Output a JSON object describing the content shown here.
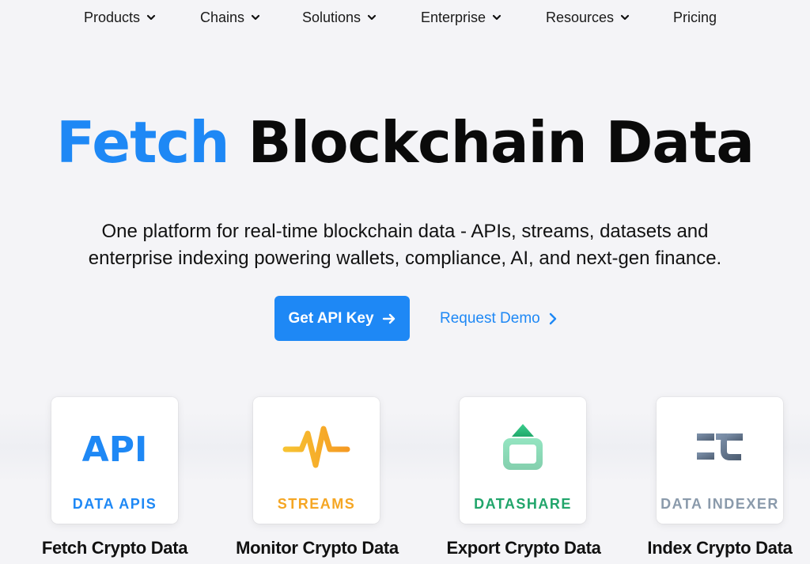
{
  "nav": {
    "items": [
      {
        "label": "Products",
        "dropdown": true
      },
      {
        "label": "Chains",
        "dropdown": true
      },
      {
        "label": "Solutions",
        "dropdown": true
      },
      {
        "label": "Enterprise",
        "dropdown": true
      },
      {
        "label": "Resources",
        "dropdown": true
      },
      {
        "label": "Pricing",
        "dropdown": false
      }
    ]
  },
  "hero": {
    "title_accent": "Fetch",
    "title_rest": "Blockchain Data",
    "subtitle_line1": "One platform for real-time blockchain data - APIs, streams, datasets and",
    "subtitle_line2": "enterprise indexing powering wallets, compliance, AI, and next-gen finance.",
    "primary_cta": "Get API Key",
    "secondary_cta": "Request Demo"
  },
  "cards": [
    {
      "icon": "api-icon",
      "label": "DATA APIS",
      "caption": "Fetch Crypto Data",
      "color": "#1e88f5"
    },
    {
      "icon": "streams-pulse-icon",
      "label": "STREAMS",
      "caption": "Monitor Crypto Data",
      "color": "#f5a623"
    },
    {
      "icon": "datashare-upload-icon",
      "label": "DATASHARE",
      "caption": "Export Crypto Data",
      "color": "#21a56b"
    },
    {
      "icon": "data-indexer-icon",
      "label": "DATA INDEXER",
      "caption": "Index Crypto Data",
      "color": "#8a9aab"
    }
  ],
  "colors": {
    "accent": "#1e88f5",
    "background": "#f4f4f7"
  }
}
